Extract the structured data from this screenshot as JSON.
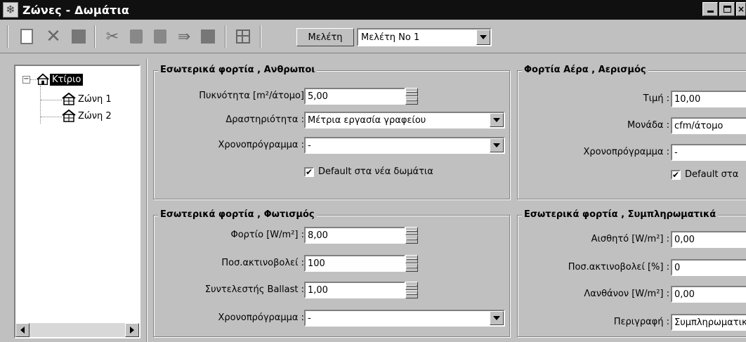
{
  "window": {
    "title": "Ζώνες - Δωμάτια",
    "close_glyph": "×"
  },
  "toolbar": {
    "study_label": "Μελέτη",
    "study_value": "Μελέτη No 1"
  },
  "tree": {
    "root_label": "Κτίριο",
    "children": [
      "Ζώνη 1",
      "Ζώνη 2"
    ]
  },
  "people": {
    "title": "Εσωτερικά φορτία ,  Ανθρωποι",
    "density_label": "Πυκνότητα [m²/άτομο]",
    "density_value": "5,00",
    "activity_label": "Δραστηριότητα :",
    "activity_value": "Μέτρια εργασία γραφείου",
    "schedule_label": "Χρονοπρόγραμμα :",
    "schedule_value": "-",
    "default_label": "Default στα νέα δωμάτια",
    "default_checked": true
  },
  "air": {
    "title": "Φορτία Αέρα ,  Αερισμός",
    "value_label": "Τιμή :",
    "value": "10,00",
    "unit_label": "Μονάδα :",
    "unit_value": "cfm/άτομο",
    "schedule_label": "Χρονοπρόγραμμα :",
    "schedule_value": "-",
    "default_label": "Default στα",
    "default_checked": true
  },
  "lighting": {
    "title": "Εσωτερικά φορτία ,  Φωτισμός",
    "load_label": "Φορτίο [W/m²] :",
    "load_value": "8,00",
    "radiant_label": "Ποσ.ακτινοβολεί :",
    "radiant_value": "100",
    "ballast_label": "Συντελεστής Ballast :",
    "ballast_value": "1,00",
    "schedule_label": "Χρονοπρόγραμμα :",
    "schedule_value": "-"
  },
  "extra": {
    "title": "Εσωτερικά φορτία ,  Συμπληρωματικά",
    "sensible_label": "Αισθητό  [W/m²] :",
    "sensible_value": "0,00",
    "radiant_label": "Ποσ.ακτινοβολεί  [%] :",
    "radiant_value": "0",
    "latent_label": "Λανθάνον  [W/m²] :",
    "latent_value": "0,00",
    "desc_label": "Περιγραφή :",
    "desc_value": "Συμπληρωματικά"
  }
}
